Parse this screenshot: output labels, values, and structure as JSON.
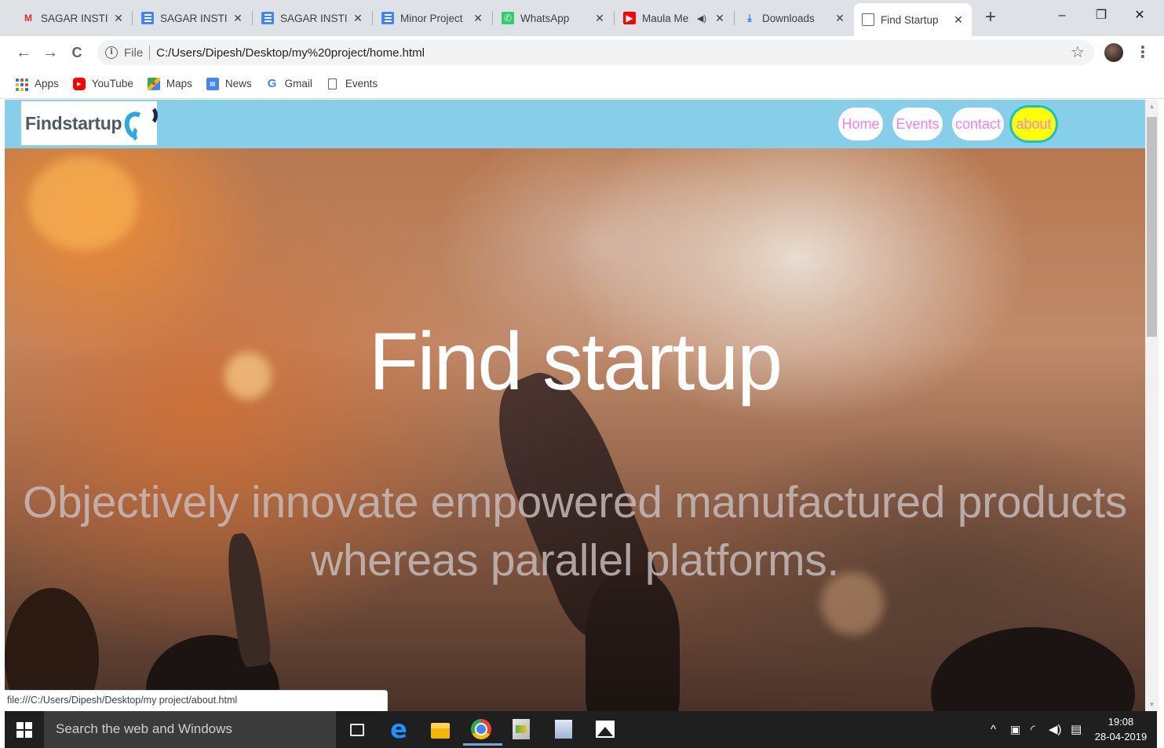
{
  "tabs": [
    {
      "label": "SAGAR INSTIT",
      "icon": "gmail-icon"
    },
    {
      "label": "SAGAR INSTIT",
      "icon": "docs-icon"
    },
    {
      "label": "SAGAR INSTIT",
      "icon": "docs-icon"
    },
    {
      "label": "Minor Project",
      "icon": "docs-icon"
    },
    {
      "label": "WhatsApp",
      "icon": "whatsapp-icon"
    },
    {
      "label": "Maula Me",
      "icon": "youtube-icon"
    },
    {
      "label": "Downloads",
      "icon": "download-icon"
    },
    {
      "label": "Find Startup",
      "icon": "page-icon",
      "active": true
    }
  ],
  "window": {
    "new_tab": "+",
    "minimize": "–",
    "restore": "❐",
    "close": "✕"
  },
  "toolbar": {
    "back": "←",
    "forward": "→",
    "reload": "C",
    "scheme": "File",
    "url": "C:/Users/Dipesh/Desktop/my%20project/home.html",
    "star": "☆",
    "menu": "⋮"
  },
  "bookmarks": [
    {
      "label": "Apps",
      "icon": "apps-grid-icon"
    },
    {
      "label": "YouTube",
      "icon": "youtube-icon"
    },
    {
      "label": "Maps",
      "icon": "maps-icon"
    },
    {
      "label": "News",
      "icon": "news-icon"
    },
    {
      "label": "Gmail",
      "icon": "google-icon"
    },
    {
      "label": "Events",
      "icon": "page-icon"
    }
  ],
  "site": {
    "logo_text": "Findstartup",
    "nav": [
      {
        "label": "Home"
      },
      {
        "label": "Events"
      },
      {
        "label": "contact"
      },
      {
        "label": "about",
        "active": true
      }
    ],
    "hero_title": "Find startup",
    "hero_subtitle_line1": "Objectively innovate empowered manufactured products",
    "hero_subtitle_line2": "whereas parallel platforms.",
    "colors": {
      "header": "#87ceeb",
      "nav_text": "#ee82ee",
      "active_nav_bg": "#ffff00",
      "active_nav_ring": "#19c3c3"
    }
  },
  "status_url": "file:///C:/Users/Dipesh/Desktop/my project/about.html",
  "taskbar": {
    "search_placeholder": "Search the web and Windows",
    "apps": [
      "task-view-icon",
      "edge-icon",
      "file-explorer-icon",
      "chrome-icon",
      "project-icon",
      "document-icon",
      "photos-icon"
    ],
    "tray_chevron": "^",
    "time": "19:08",
    "date": "28-04-2019"
  }
}
